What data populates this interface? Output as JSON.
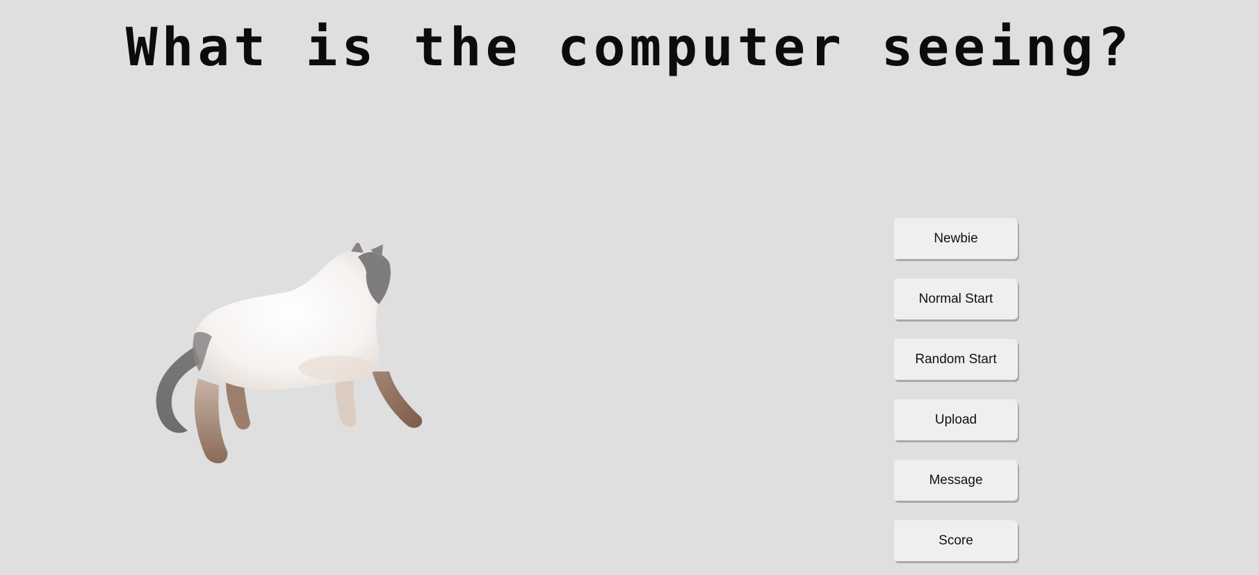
{
  "page": {
    "title": "What is the computer seeing?"
  },
  "image": {
    "subject_icon": "cat-image"
  },
  "menu": {
    "buttons": [
      {
        "label": "Newbie"
      },
      {
        "label": "Normal Start"
      },
      {
        "label": "Random Start"
      },
      {
        "label": "Upload"
      },
      {
        "label": "Message"
      },
      {
        "label": "Score"
      }
    ]
  },
  "colors": {
    "background": "#dfdfdf",
    "button_face": "#efefef",
    "button_shadow": "#a9a9a9",
    "title_text": "#0c0c0c"
  }
}
